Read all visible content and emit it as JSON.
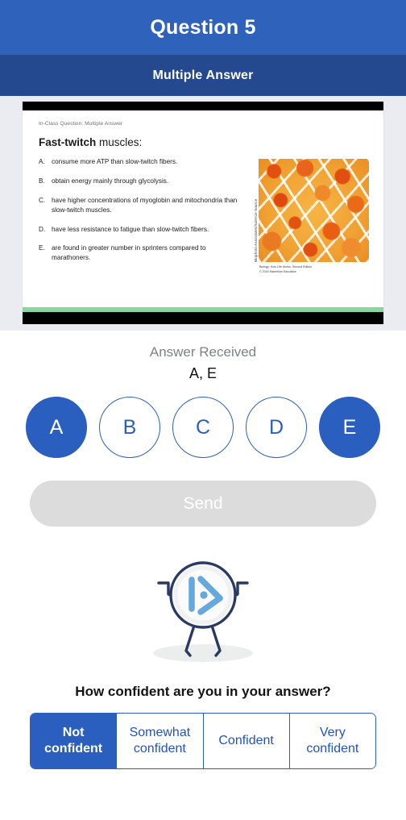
{
  "header": {
    "title": "Question 5",
    "subtitle": "Multiple Answer"
  },
  "slide": {
    "eyebrow": "In-Class Question: Multiple Answer",
    "heading_bold": "Fast-twitch",
    "heading_rest": " muscles:",
    "choices": [
      {
        "letter": "A.",
        "text": "consume more ATP than slow-twitch fibers."
      },
      {
        "letter": "B.",
        "text": "obtain energy mainly through glycolysis."
      },
      {
        "letter": "C.",
        "text": "have higher concentrations of myoglobin and mitochondria than slow-twitch muscles."
      },
      {
        "letter": "D.",
        "text": "have less resistance to fatigue than slow-twitch fibers."
      },
      {
        "letter": "E.",
        "text": "are found in greater number in sprinters compared to marathoners."
      }
    ],
    "figure_credit": "Biophoto Associates/Science Source",
    "figure_caption_line1": "Biology: How Life Works, Second Edition",
    "figure_caption_line2": "© 2016 Macmillan Education"
  },
  "answer": {
    "status_label": "Answer Received",
    "value": "A, E",
    "options": [
      {
        "label": "A",
        "selected": true
      },
      {
        "label": "B",
        "selected": false
      },
      {
        "label": "C",
        "selected": false
      },
      {
        "label": "D",
        "selected": false
      },
      {
        "label": "E",
        "selected": true
      }
    ]
  },
  "send": {
    "label": "Send",
    "disabled": true
  },
  "mascot": {
    "icon_name": "play-triangle-logo-mascot"
  },
  "confidence": {
    "question": "How confident are you in your answer?",
    "options": [
      {
        "label": "Not confident",
        "selected": true
      },
      {
        "label": "Somewhat confident",
        "selected": false
      },
      {
        "label": "Confident",
        "selected": false
      },
      {
        "label": "Very confident",
        "selected": false
      }
    ]
  },
  "colors": {
    "header_blue": "#2f62bb",
    "subheader_blue": "#24498f",
    "accent_blue": "#2b5fbf",
    "link_blue": "#2052c4",
    "disabled_gray": "#dcdcdd",
    "stage_gray": "#eaecf1",
    "slide_green": "#8ad6a0"
  }
}
